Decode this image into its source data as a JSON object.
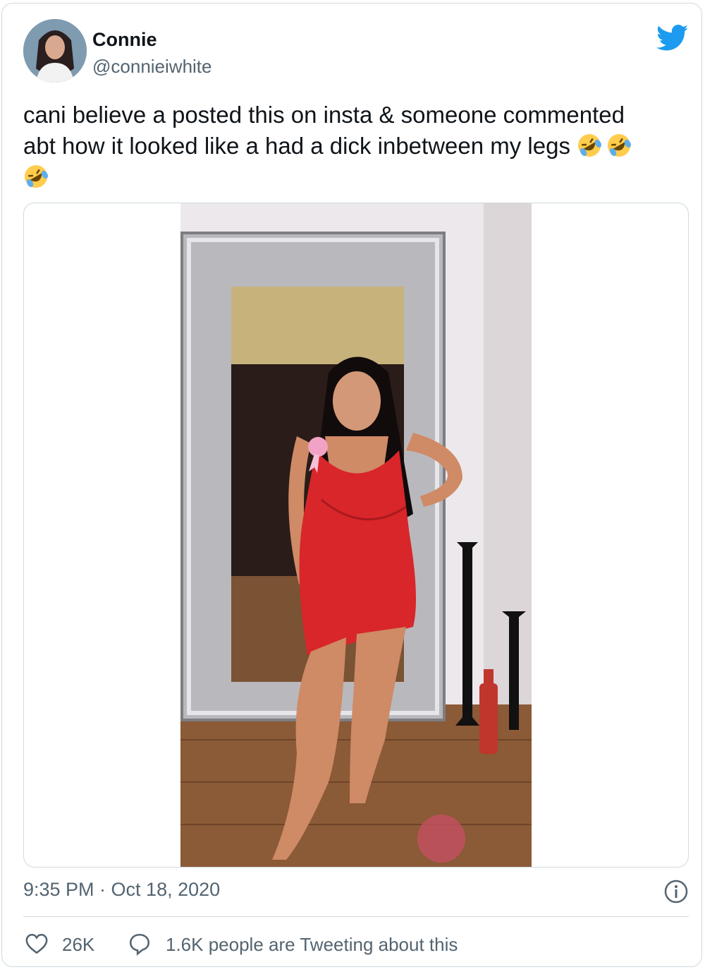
{
  "user": {
    "display_name": "Connie",
    "handle": "@connieiwhite"
  },
  "tweet": {
    "text_line1": "cani believe a posted this on insta & someone commented",
    "text_line2": "abt how it looked like a had a dick inbetween my legs",
    "emoji_name": "rolling-on-the-floor-laughing",
    "emoji_count": 3
  },
  "meta": {
    "timestamp": "9:35 PM · Oct 18, 2020",
    "likes": "26K",
    "tweeting_about": "1.6K people are Tweeting about this"
  },
  "colors": {
    "twitter_blue": "#1d9bf0",
    "text": "#0f1419",
    "secondary": "#536471",
    "border": "#cfd9de",
    "dress_red": "#d8262a"
  },
  "icons": [
    "twitter-bird-icon",
    "info-icon",
    "heart-icon",
    "reply-bubble-icon"
  ]
}
